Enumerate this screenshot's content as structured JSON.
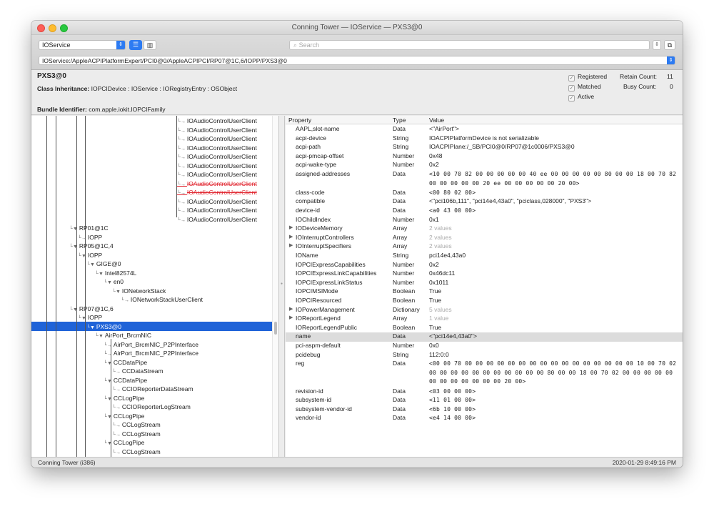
{
  "window": {
    "title": "Conning Tower — IOService — PXS3@0"
  },
  "toolbar": {
    "plane": "IOService",
    "search_placeholder": "Search",
    "path": "IOService:/AppleACPIPlatformExpert/PCI0@0/AppleACPIPCI/RP07@1C,6/IOPP/PXS3@0"
  },
  "info": {
    "name": "PXS3@0",
    "class_label": "Class Inheritance:",
    "class_value": "IOPCIDevice : IOService : IORegistryEntry : OSObject",
    "bundle_label": "Bundle Identifier:",
    "bundle_value": "com.apple.iokit.IOPCIFamily",
    "registered": "Registered",
    "matched": "Matched",
    "active": "Active",
    "retain_label": "Retain Count:",
    "retain_value": "11",
    "busy_label": "Busy Count:",
    "busy_value": "0"
  },
  "tree": {
    "nodes": [
      "IOAudioControlUserClient",
      "IOAudioControlUserClient",
      "IOAudioControlUserClient",
      "IOAudioControlUserClient",
      "IOAudioControlUserClient",
      "IOAudioControlUserClient",
      "IOAudioControlUserClient",
      "IOAudioControlUserClient",
      "IOAudioControlUserClient",
      "IOAudioControlUserClient",
      "IOAudioControlUserClient",
      "IOAudioControlUserClient",
      "RP01@1C",
      "IOPP",
      "RP05@1C,4",
      "IOPP",
      "GIGE@0",
      "Intel82574L",
      "en0",
      "IONetworkStack",
      "IONetworkStackUserClient",
      "RP07@1C,6",
      "IOPP",
      "PXS3@0",
      "AirPort_BrcmNIC",
      "AirPort_BrcmNIC_P2PInterface",
      "AirPort_BrcmNIC_P2PInterface",
      "CCDataPipe",
      "CCDataStream",
      "CCDataPipe",
      "CCIOReporterDataStream",
      "CCLogPipe",
      "CCIOReporterLogStream",
      "CCLogPipe",
      "CCLogStream",
      "CCLogStream",
      "CCLogPipe",
      "CCLogStream"
    ]
  },
  "properties": {
    "headers": {
      "property": "Property",
      "type": "Type",
      "value": "Value"
    },
    "rows": [
      {
        "p": "AAPL,slot-name",
        "t": "Data",
        "v": "<\"AirPort\">"
      },
      {
        "p": "acpi-device",
        "t": "String",
        "v": "IOACPIPlatformDevice is not serializable"
      },
      {
        "p": "acpi-path",
        "t": "String",
        "v": "IOACPIPlane:/_SB/PCI0@0/RP07@1c0006/PXS3@0"
      },
      {
        "p": "acpi-pmcap-offset",
        "t": "Number",
        "v": "0x48"
      },
      {
        "p": "acpi-wake-type",
        "t": "Number",
        "v": "0x2"
      },
      {
        "p": "assigned-addresses",
        "t": "Data",
        "v": "<10 00 70 82 00 00 00 00 00 40 ee 00 00 00 00 00 80 00 00 18 00 70 82 00 00 00 00 00 20 ee 00 00 00 00 00 20 00>"
      },
      {
        "p": "class-code",
        "t": "Data",
        "v": "<00 80 02 00>"
      },
      {
        "p": "compatible",
        "t": "Data",
        "v": "<\"pci106b,111\", \"pci14e4,43a0\", \"pciclass,028000\", \"PXS3\">"
      },
      {
        "p": "device-id",
        "t": "Data",
        "v": "<a0 43 00 00>"
      },
      {
        "p": "IOChildIndex",
        "t": "Number",
        "v": "0x1"
      },
      {
        "p": "IODeviceMemory",
        "t": "Array",
        "v": "2 values"
      },
      {
        "p": "IOInterruptControllers",
        "t": "Array",
        "v": "2 values"
      },
      {
        "p": "IOInterruptSpecifiers",
        "t": "Array",
        "v": "2 values"
      },
      {
        "p": "IOName",
        "t": "String",
        "v": "pci14e4,43a0"
      },
      {
        "p": "IOPCIExpressCapabilities",
        "t": "Number",
        "v": "0x2"
      },
      {
        "p": "IOPCIExpressLinkCapabilities",
        "t": "Number",
        "v": "0x46dc11"
      },
      {
        "p": "IOPCIExpressLinkStatus",
        "t": "Number",
        "v": "0x1011"
      },
      {
        "p": "IOPCIMSIMode",
        "t": "Boolean",
        "v": "True"
      },
      {
        "p": "IOPCIResourced",
        "t": "Boolean",
        "v": "True"
      },
      {
        "p": "IOPowerManagement",
        "t": "Dictionary",
        "v": "5 values"
      },
      {
        "p": "IOReportLegend",
        "t": "Array",
        "v": "1 value"
      },
      {
        "p": "IOReportLegendPublic",
        "t": "Boolean",
        "v": "True"
      },
      {
        "p": "name",
        "t": "Data",
        "v": "<\"pci14e4,43a0\">"
      },
      {
        "p": "pci-aspm-default",
        "t": "Number",
        "v": "0x0"
      },
      {
        "p": "pcidebug",
        "t": "String",
        "v": "112:0:0"
      },
      {
        "p": "reg",
        "t": "Data",
        "v": "<00 00 70 00 00 00 00 00 00 00 00 00 00 00 00 00 00 00 00 10 00 70 02 00 00 00 00 00 00 00 00 00 00 00 80 00 00 18 00 70 02 00 00 00 00 00 00 00 00 00 00 00 00 20 00>"
      },
      {
        "p": "revision-id",
        "t": "Data",
        "v": "<03 00 00 00>"
      },
      {
        "p": "subsystem-id",
        "t": "Data",
        "v": "<11 01 00 00>"
      },
      {
        "p": "subsystem-vendor-id",
        "t": "Data",
        "v": "<6b 10 00 00>"
      },
      {
        "p": "vendor-id",
        "t": "Data",
        "v": "<e4 14 00 00>"
      }
    ]
  },
  "status": {
    "left": "Conning Tower (i386)",
    "right": "2020-01-29 8:49:16 PM"
  }
}
